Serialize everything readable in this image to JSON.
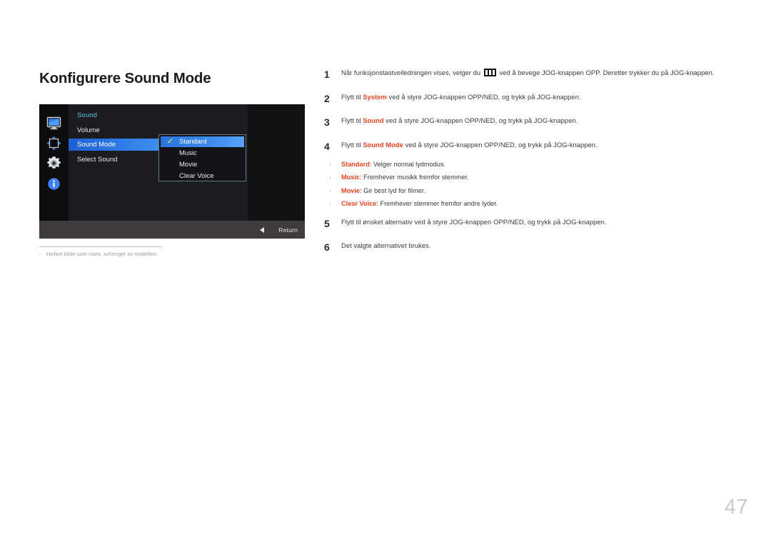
{
  "page": {
    "title": "Konfigurere Sound Mode",
    "number": "47"
  },
  "figure": {
    "osd": {
      "heading": "Sound",
      "sidebar_icons": [
        {
          "name": "display-icon",
          "label": "Picture"
        },
        {
          "name": "picture-size-icon",
          "label": "OnScreen Display"
        },
        {
          "name": "gear-icon",
          "label": "System"
        },
        {
          "name": "info-icon",
          "label": "Information"
        }
      ],
      "menu_items": [
        {
          "label": "Volume",
          "selected": false
        },
        {
          "label": "Sound Mode",
          "selected": true
        },
        {
          "label": "Select Sound",
          "selected": false
        }
      ],
      "dropdown": {
        "options": [
          {
            "label": "Standard",
            "checked": true
          },
          {
            "label": "Music",
            "checked": false
          },
          {
            "label": "Movie",
            "checked": false
          },
          {
            "label": "Clear Voice",
            "checked": false
          }
        ]
      },
      "bottom_bar": {
        "return_label": "Return",
        "return_icon": "left-arrow-icon"
      }
    },
    "note_dash": "-",
    "note": "Hvilket bilde som vises, avhenger av modellen."
  },
  "steps": [
    {
      "num": "1",
      "html": "Når funksjonstastveiledningen vises, velger du <span class=\"menu-glyph\" data-name=\"jog-menu-icon\" data-interactable=\"false\"><i></i><i></i><i></i></span> ved å bevege JOG-knappen OPP. Deretter trykker du på JOG-knappen."
    },
    {
      "num": "2",
      "html": "Flytt til <b>System</b> ved å styre JOG-knappen OPP/NED, og trykk på JOG-knappen."
    },
    {
      "num": "3",
      "html": "Flytt til <b>Sound</b> ved å styre JOG-knappen OPP/NED, og trykk på JOG-knappen."
    },
    {
      "num": "4",
      "html": "Flytt til <b>Sound Mode</b> ved å styre JOG-knappen OPP/NED, og trykk på JOG-knappen."
    }
  ],
  "bullets": [
    {
      "dot": "·",
      "html": "<b>Standard</b>: Velger normal lydmodus."
    },
    {
      "dot": "·",
      "html": "<b>Music</b>: Fremhever musikk fremfor stemmer."
    },
    {
      "dot": "·",
      "html": "<b>Movie</b>: Gir best lyd for filmer."
    },
    {
      "dot": "·",
      "html": "<b>Clear Voice</b>: Fremhever stemmer fremfor andre lyder."
    }
  ],
  "steps_after": [
    {
      "num": "5",
      "html": "Flytt til ønsket alternativ ved å styre JOG-knappen OPP/NED, og trykk på JOG-knappen."
    },
    {
      "num": "6",
      "html": "Det valgte alternativet brukes."
    }
  ],
  "colors": {
    "accent_red": "#e8441f",
    "osd_heading_blue": "#5ec6e8",
    "osd_highlight_blue": "#2f7de8",
    "check_green": "#c9e048",
    "page_number_gray": "#c9c9c9"
  }
}
